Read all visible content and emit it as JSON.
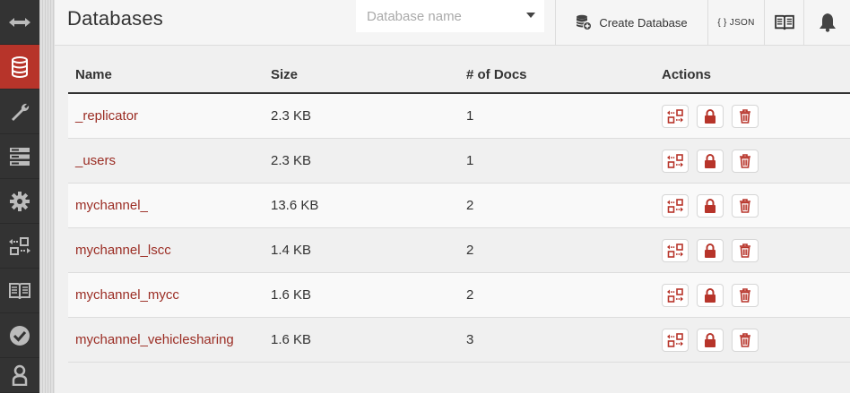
{
  "sidebar": {
    "items": [
      {
        "icon": "expand-arrows-icon",
        "active": false
      },
      {
        "icon": "database-icon",
        "active": true
      },
      {
        "icon": "wrench-icon",
        "active": false
      },
      {
        "icon": "server-rack-icon",
        "active": false
      },
      {
        "icon": "gear-icon",
        "active": false
      },
      {
        "icon": "replication-icon",
        "active": false
      },
      {
        "icon": "book-icon",
        "active": false
      },
      {
        "icon": "checkmark-circle-icon",
        "active": false
      },
      {
        "icon": "user-icon",
        "active": false
      }
    ],
    "accent_color": "#b7342a"
  },
  "header": {
    "title": "Databases",
    "search_placeholder": "Database name",
    "create_label": "Create Database",
    "json_label": "{ } JSON"
  },
  "table": {
    "columns": [
      "Name",
      "Size",
      "# of Docs",
      "Actions"
    ],
    "rows": [
      {
        "name": "_replicator",
        "size": "2.3 KB",
        "docs": "1"
      },
      {
        "name": "_users",
        "size": "2.3 KB",
        "docs": "1"
      },
      {
        "name": "mychannel_",
        "size": "13.6 KB",
        "docs": "2"
      },
      {
        "name": "mychannel_lscc",
        "size": "1.4 KB",
        "docs": "2"
      },
      {
        "name": "mychannel_mycc",
        "size": "1.6 KB",
        "docs": "2"
      },
      {
        "name": "mychannel_vehiclesharing",
        "size": "1.6 KB",
        "docs": "3"
      }
    ],
    "link_color": "#9b2d24",
    "action_icons": [
      "replicate-icon",
      "lock-icon",
      "trash-icon"
    ]
  }
}
